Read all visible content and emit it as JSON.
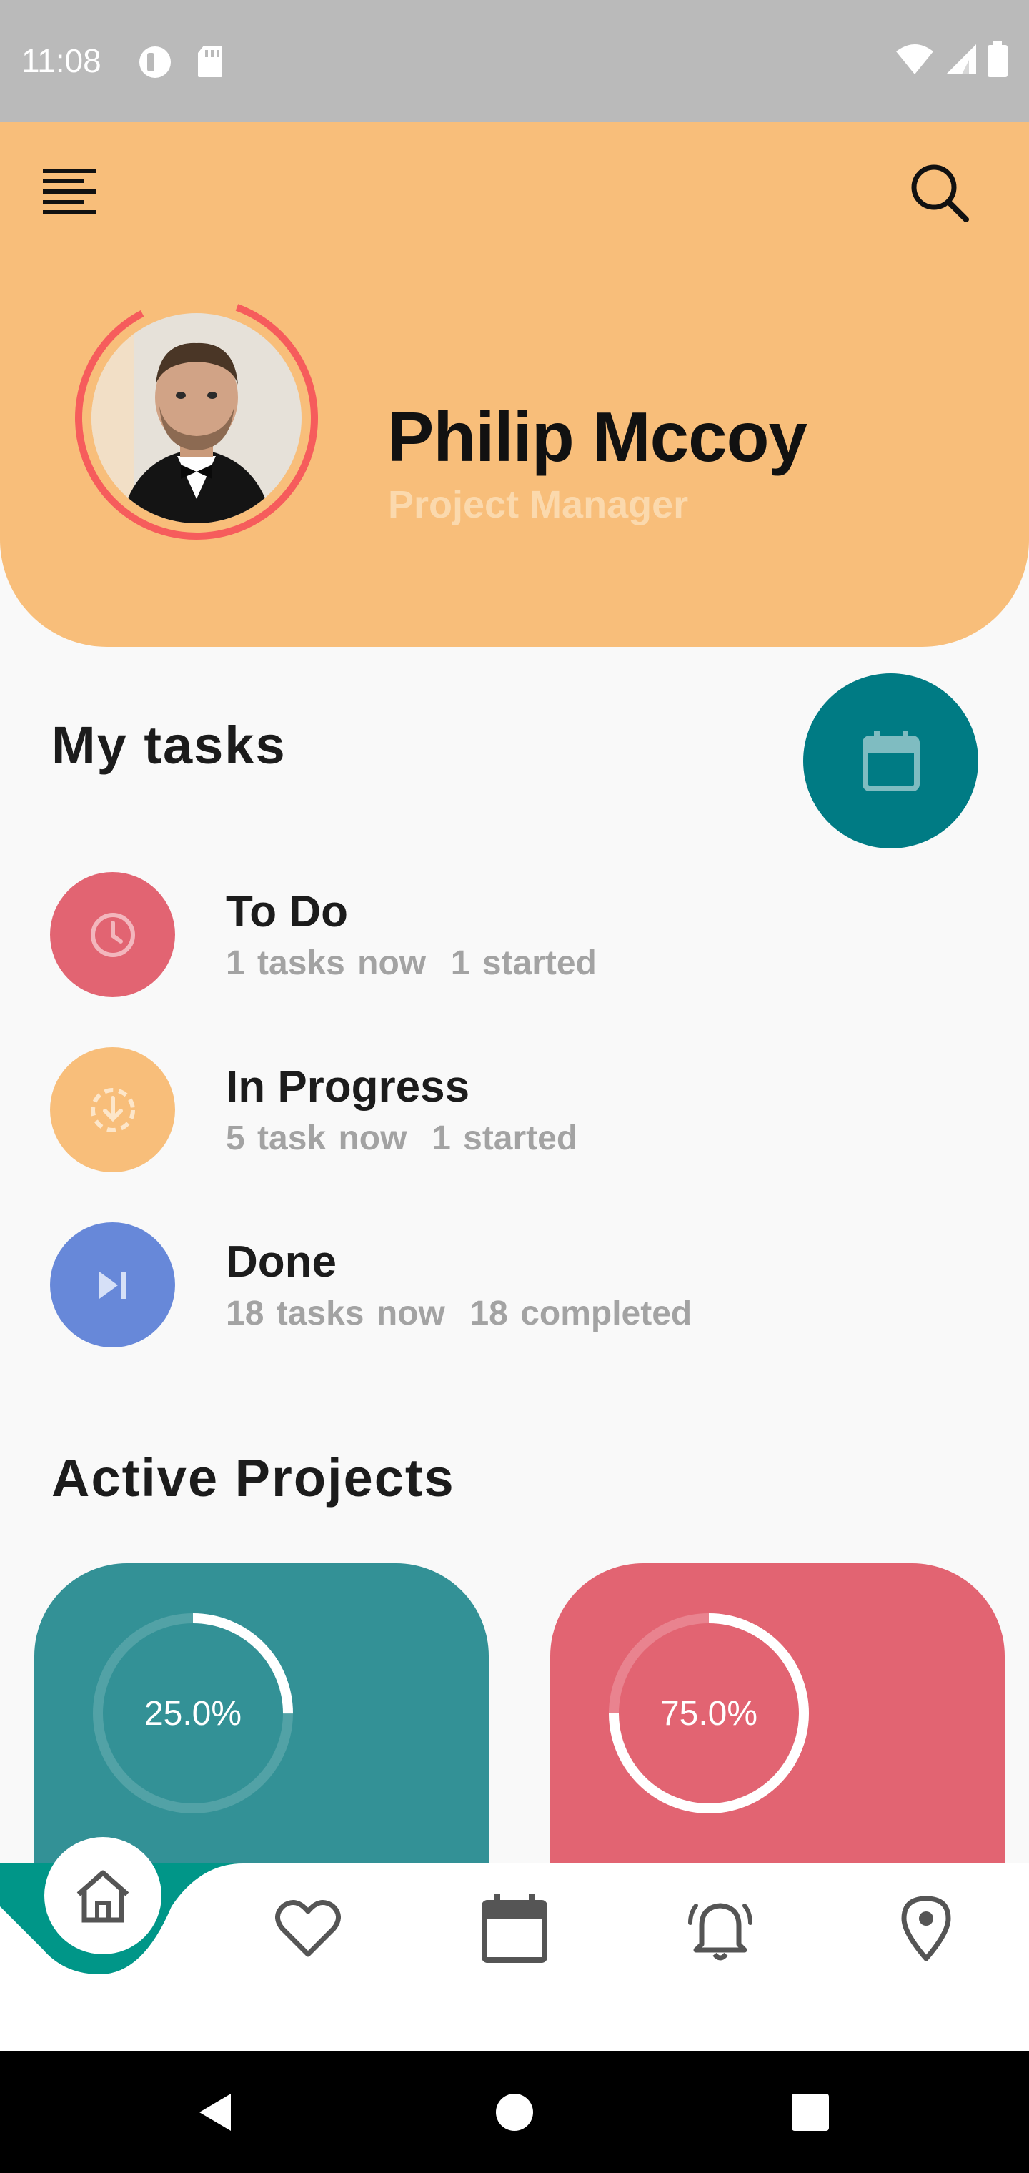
{
  "status_bar": {
    "time": "11:08"
  },
  "profile": {
    "name": "Philip Mccoy",
    "role": "Project Manager"
  },
  "tasks": {
    "title": "My tasks",
    "items": [
      {
        "title": "To Do",
        "subtitle": "1 tasks now  1 started",
        "icon": "clock-icon",
        "color": "#e26472"
      },
      {
        "title": "In Progress",
        "subtitle": "5 task now  1 started",
        "icon": "download-dashed-icon",
        "color": "#f8be7a"
      },
      {
        "title": "Done",
        "subtitle": "18 tasks now  18 completed",
        "icon": "skip-next-icon",
        "color": "#6788d9"
      }
    ]
  },
  "projects": {
    "title": "Active Projects",
    "items": [
      {
        "progress_label": "25.0%",
        "progress": 0.25,
        "color": "#339196"
      },
      {
        "progress_label": "75.0%",
        "progress": 0.75,
        "color": "#e26472"
      }
    ]
  },
  "colors": {
    "header": "#f8be7a",
    "fab": "#007b84",
    "nav_active": "#009688",
    "avatar_ring": "#f65c5c"
  },
  "bottom_nav": {
    "items": [
      "home-icon",
      "heart-icon",
      "calendar-icon",
      "bell-icon",
      "location-pin-icon"
    ],
    "active": "home-icon"
  }
}
